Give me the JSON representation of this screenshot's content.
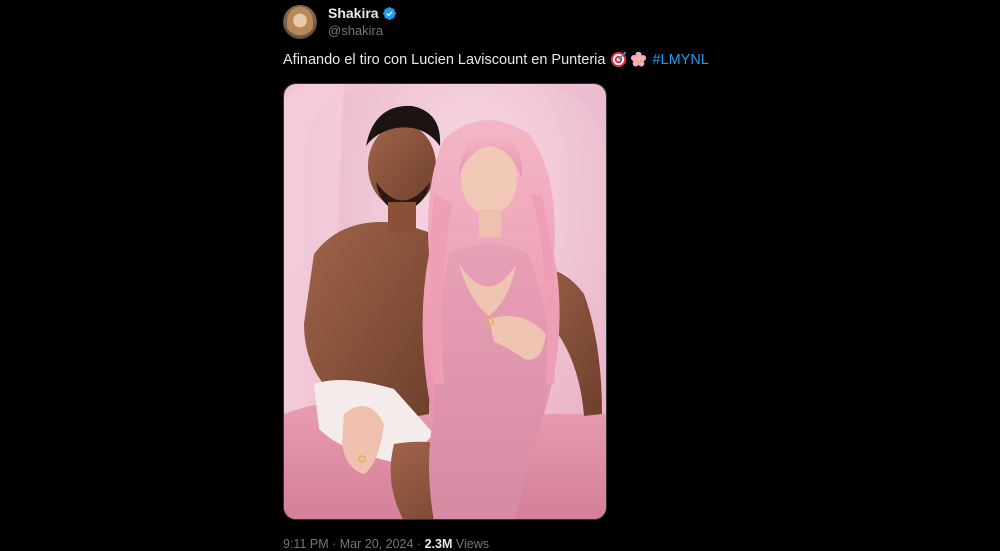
{
  "author": {
    "display_name": "Shakira",
    "handle": "@shakira",
    "verified": true,
    "avatar_icon": "profile-avatar"
  },
  "tweet": {
    "text": "Afinando el tiro con Lucien Laviscount en Punteria",
    "emojis": [
      "direct-hit-emoji",
      "pink-flower-emoji"
    ],
    "hashtag": "#LMYNL",
    "media_icon": "photo-couple-pink-backdrop"
  },
  "meta": {
    "time": "9:11 PM",
    "separator": "·",
    "date": "Mar 20, 2024",
    "views_count": "2.3M",
    "views_label": "Views"
  },
  "colors": {
    "background": "#000000",
    "text_primary": "#e7e9ea",
    "text_secondary": "#71767b",
    "link": "#1d9bf0",
    "verified_badge": "#1d9bf0"
  }
}
